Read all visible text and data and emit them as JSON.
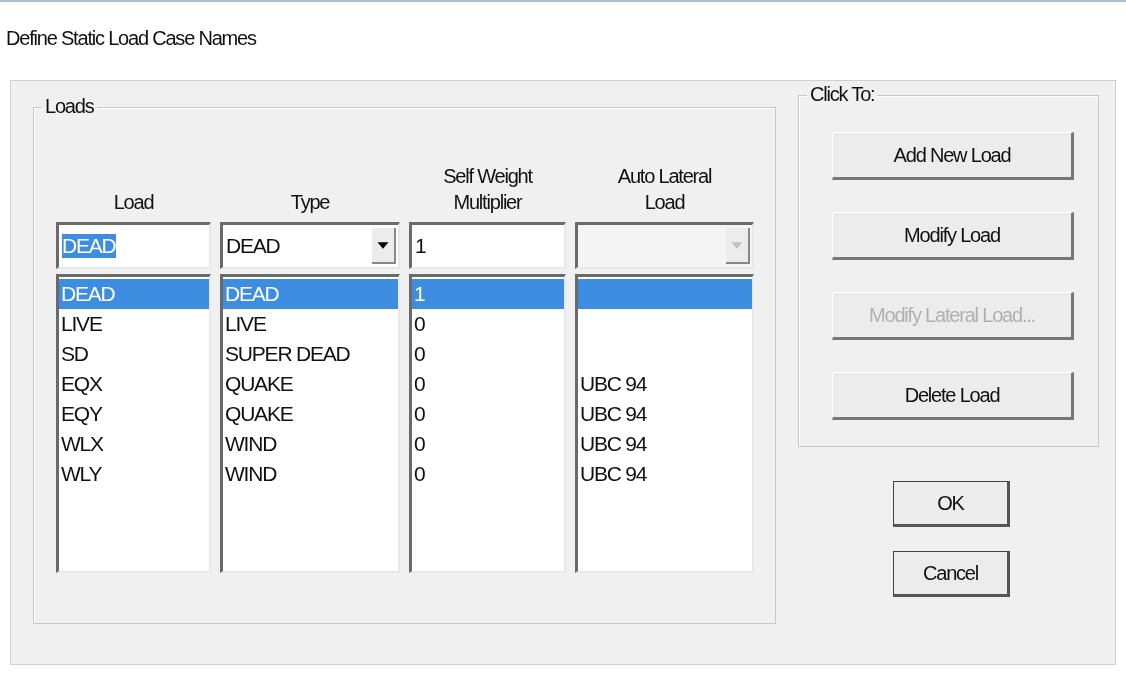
{
  "window": {
    "title": "Define Static Load Case Names"
  },
  "loads": {
    "label": "Loads",
    "columns": [
      {
        "label": "Load"
      },
      {
        "label": "Type"
      },
      {
        "label": "Self Weight Multiplier"
      },
      {
        "label": "Auto Lateral Load"
      }
    ],
    "load_field": {
      "value": "DEAD",
      "text_selected": true
    },
    "type_dropdown": {
      "value": "DEAD",
      "disabled": false
    },
    "multiplier_field": {
      "value": "1"
    },
    "auto_lateral_dropdown": {
      "disabled": true
    },
    "rows": [
      {
        "load": "DEAD",
        "type": "DEAD",
        "multiplier": "1",
        "selected": true
      },
      {
        "load": "LIVE",
        "type": "LIVE",
        "multiplier": "0",
        "selected": false
      },
      {
        "load": "SD",
        "type": "SUPER DEAD",
        "multiplier": "0",
        "selected": false
      },
      {
        "load": "EQX",
        "type": "QUAKE",
        "multiplier": "0",
        "auto_lateral": "UBC 94",
        "selected": false
      },
      {
        "load": "EQY",
        "type": "QUAKE",
        "multiplier": "0",
        "auto_lateral": "UBC 94",
        "selected": false
      },
      {
        "load": "WLX",
        "type": "WIND",
        "multiplier": "0",
        "auto_lateral": "UBC 94",
        "selected": false
      },
      {
        "load": "WLY",
        "type": "WIND",
        "multiplier": "0",
        "auto_lateral": "UBC 94",
        "selected": false
      }
    ]
  },
  "click_to": {
    "label": "Click To:",
    "buttons": [
      {
        "label": "Add New Load",
        "disabled": false
      },
      {
        "label": "Modify Load",
        "disabled": false
      },
      {
        "label": "Modify Lateral Load...",
        "disabled": true
      },
      {
        "label": "Delete Load",
        "disabled": false
      }
    ]
  },
  "buttons": [
    {
      "label": "OK"
    },
    {
      "label": "Cancel"
    }
  ]
}
